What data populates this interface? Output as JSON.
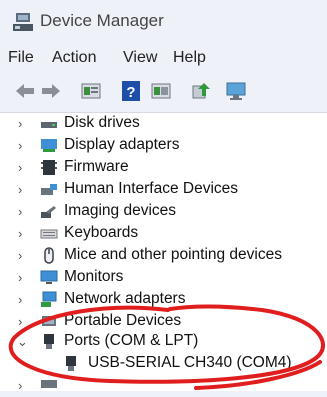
{
  "window": {
    "title": "Device Manager"
  },
  "menu": [
    "File",
    "Action",
    "View",
    "Help"
  ],
  "toolbar": {
    "icons": [
      "back-arrow-icon",
      "forward-arrow-icon",
      "properties-icon",
      "help-icon",
      "show-hidden-icon",
      "update-driver-icon",
      "monitor-scan-icon"
    ]
  },
  "tree": {
    "categories": [
      {
        "label": "Disk drives",
        "icon": "disk-drive-icon",
        "expanded": false
      },
      {
        "label": "Display adapters",
        "icon": "display-adapter-icon",
        "expanded": false
      },
      {
        "label": "Firmware",
        "icon": "firmware-icon",
        "expanded": false
      },
      {
        "label": "Human Interface Devices",
        "icon": "hid-icon",
        "expanded": false
      },
      {
        "label": "Imaging devices",
        "icon": "camera-icon",
        "expanded": false
      },
      {
        "label": "Keyboards",
        "icon": "keyboard-icon",
        "expanded": false
      },
      {
        "label": "Mice and other pointing devices",
        "icon": "mouse-icon",
        "expanded": false
      },
      {
        "label": "Monitors",
        "icon": "monitor-icon",
        "expanded": false
      },
      {
        "label": "Network adapters",
        "icon": "network-adapter-icon",
        "expanded": false
      },
      {
        "label": "Portable Devices",
        "icon": "portable-device-icon",
        "expanded": false
      },
      {
        "label": "Ports (COM & LPT)",
        "icon": "port-icon",
        "expanded": true
      }
    ],
    "port_child": {
      "label": "USB-SERIAL CH340 (COM4)",
      "icon": "port-icon"
    }
  },
  "colors": {
    "annotation": "#e01e1e",
    "accent": "#1e6fd9"
  }
}
